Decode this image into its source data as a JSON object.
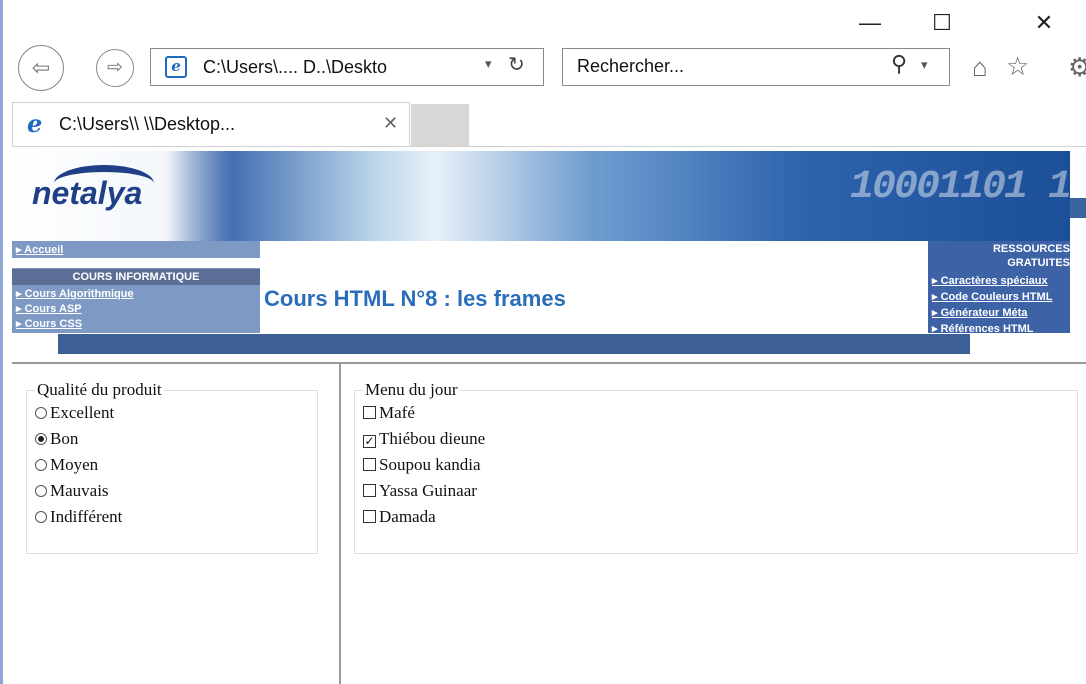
{
  "window": {
    "minimize": "—",
    "maximize": "☐",
    "close": "✕"
  },
  "nav": {
    "back": "⇦",
    "forward": "⇨",
    "address_url": "C:\\Users\\.... D..\\Deskto",
    "refresh": "↻",
    "search_placeholder": "Rechercher...",
    "search_icon": "search-icon",
    "dropdown": "▾"
  },
  "tab": {
    "title": "C:\\Users\\\\           \\\\Desktop...",
    "close": "✕"
  },
  "page": {
    "logo": "netalya",
    "banner_digits": "10001101 1",
    "left_nav": {
      "accueil": "Accueil",
      "heading": "COURS INFORMATIQUE",
      "links": [
        "Cours Algorithmique",
        "Cours ASP",
        "Cours CSS"
      ]
    },
    "title": "Cours HTML N°8 : les frames",
    "right_nav": {
      "heading_line1": "RESSOURCES",
      "heading_line2": "GRATUITES",
      "links": [
        "Caractères spéciaux",
        "Code Couleurs HTML",
        "Générateur Méta",
        "Références HTML"
      ]
    }
  },
  "qualite": {
    "legend": "Qualité du produit",
    "options": [
      {
        "label": "Excellent",
        "checked": false
      },
      {
        "label": "Bon",
        "checked": true
      },
      {
        "label": "Moyen",
        "checked": false
      },
      {
        "label": "Mauvais",
        "checked": false
      },
      {
        "label": "Indifférent",
        "checked": false
      }
    ]
  },
  "menu": {
    "legend": "Menu du jour",
    "items": [
      {
        "label": "Mafé",
        "checked": false
      },
      {
        "label": "Thiébou dieune",
        "checked": true
      },
      {
        "label": "Soupou kandia",
        "checked": false
      },
      {
        "label": "Yassa Guinaar",
        "checked": false
      },
      {
        "label": "Damada",
        "checked": false
      }
    ]
  }
}
